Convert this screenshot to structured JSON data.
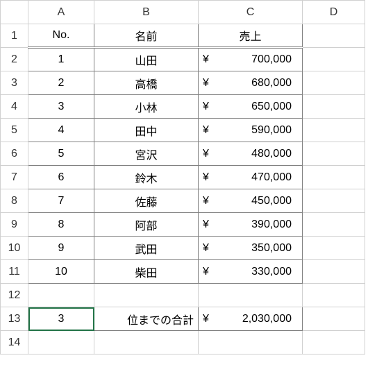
{
  "columns": [
    "A",
    "B",
    "C",
    "D"
  ],
  "row_numbers": [
    1,
    2,
    3,
    4,
    5,
    6,
    7,
    8,
    9,
    10,
    11,
    12,
    13,
    14
  ],
  "header": {
    "no": "No.",
    "name": "名前",
    "sales": "売上"
  },
  "rows": [
    {
      "no": "1",
      "name": "山田",
      "yen": "¥",
      "sales": "700,000"
    },
    {
      "no": "2",
      "name": "高橋",
      "yen": "¥",
      "sales": "680,000"
    },
    {
      "no": "3",
      "name": "小林",
      "yen": "¥",
      "sales": "650,000"
    },
    {
      "no": "4",
      "name": "田中",
      "yen": "¥",
      "sales": "590,000"
    },
    {
      "no": "5",
      "name": "宮沢",
      "yen": "¥",
      "sales": "480,000"
    },
    {
      "no": "6",
      "name": "鈴木",
      "yen": "¥",
      "sales": "470,000"
    },
    {
      "no": "7",
      "name": "佐藤",
      "yen": "¥",
      "sales": "450,000"
    },
    {
      "no": "8",
      "name": "阿部",
      "yen": "¥",
      "sales": "390,000"
    },
    {
      "no": "9",
      "name": "武田",
      "yen": "¥",
      "sales": "350,000"
    },
    {
      "no": "10",
      "name": "柴田",
      "yen": "¥",
      "sales": "330,000"
    }
  ],
  "summary": {
    "rank": "3",
    "label": "位までの合計",
    "yen": "¥",
    "total": "2,030,000"
  },
  "chart_data": {
    "type": "table",
    "title": "売上",
    "categories": [
      "山田",
      "高橋",
      "小林",
      "田中",
      "宮沢",
      "鈴木",
      "佐藤",
      "阿部",
      "武田",
      "柴田"
    ],
    "values": [
      700000,
      680000,
      650000,
      590000,
      480000,
      470000,
      450000,
      390000,
      350000,
      330000
    ],
    "summary": {
      "top_n": 3,
      "label": "位までの合計",
      "total": 2030000
    }
  }
}
